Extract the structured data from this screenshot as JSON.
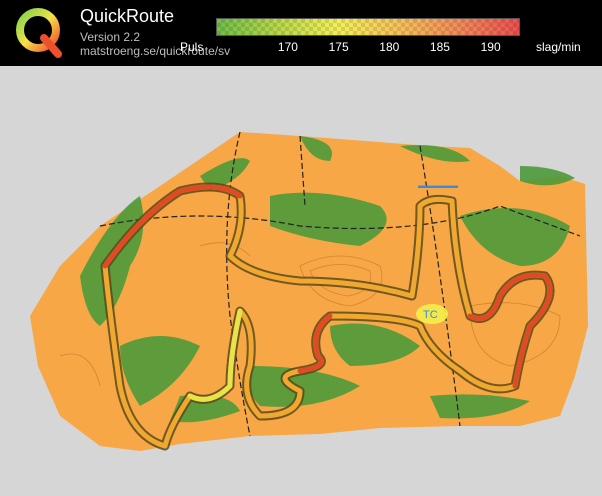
{
  "header": {
    "app_name": "QuickRoute",
    "version": "Version 2.2",
    "url": "matstroeng.se/quickroute/sv",
    "logo_letter": "Q"
  },
  "legend": {
    "label": "Puls",
    "unit": "slag/min",
    "ticks": [
      "170",
      "175",
      "180",
      "185",
      "190"
    ],
    "range": [
      163,
      193
    ],
    "colors": [
      "#6fbe4a",
      "#b8d84a",
      "#f3f05a",
      "#f7c25a",
      "#f28c5a",
      "#ee5050"
    ]
  },
  "map": {
    "annotation_label": "TC",
    "colors": {
      "terrain": "#f7a745",
      "forest": "#4d9a3a",
      "route_high": "#e04b24",
      "route_mid": "#f0a830",
      "route_low": "#e9e34a",
      "route_outline": "#5a4a1a"
    }
  }
}
